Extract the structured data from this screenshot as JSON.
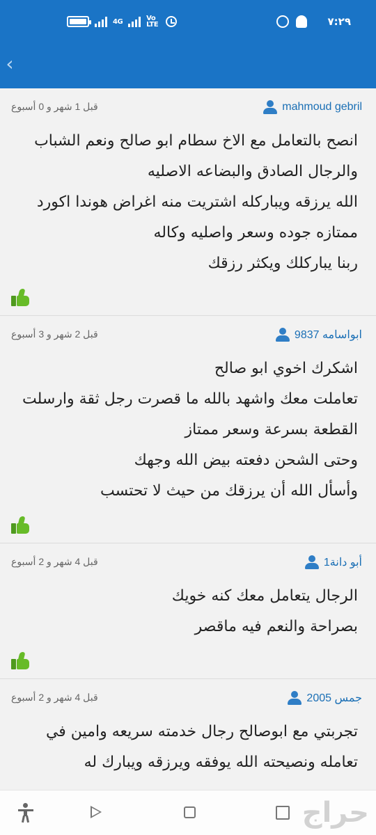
{
  "status_bar": {
    "time": "٧:٢٩",
    "network_label": "4G",
    "volte_label": "Vo LTE",
    "icons": [
      "battery-icon",
      "signal-icon",
      "alarm-icon",
      "whatsapp-icon",
      "snapchat-icon"
    ]
  },
  "app_bar": {
    "back_label": "‹",
    "color": "#1a74c6"
  },
  "reviews": [
    {
      "user": "mahmoud gebril",
      "time": "قبل 1 شهر و 0 أسبوع",
      "lines": [
        "انصح بالتعامل مع الاخ سطام ابو صالح ونعم الشباب",
        "والرجال الصادق والبضاعه الاصليه",
        "الله يرزقه ويباركله اشتريت منه اغراض هوندا اكورد",
        "ممتازه جوده وسعر واصليه وكاله",
        "ربنا يباركلك ويكثر رزقك"
      ]
    },
    {
      "user": "ابواسامه 9837",
      "time": "قبل 2 شهر و 3 أسبوع",
      "lines": [
        "اشكرك اخوي ابو صالح",
        "تعاملت معك  واشهد بالله ما قصرت رجل ثقة وارسلت",
        "القطعة بسرعة وسعر ممتاز",
        "وحتى الشحن دفعته بيض الله وجهك",
        "وأسأل الله أن يرزقك من حيث لا تحتسب"
      ]
    },
    {
      "user": "أبو دانة1",
      "time": "قبل 4 شهر و 2 أسبوع",
      "lines": [
        "الرجال يتعامل معك كنه خويك",
        "بصراحة والنعم فيه ماقصر"
      ]
    },
    {
      "user": "جمس 2005",
      "time": "قبل 4 شهر و 2 أسبوع",
      "lines": [
        "تجربتي مع ابوصالح رجال خدمته سريعه وامين في",
        "تعامله ونصيحته الله يوفقه ويرزقه ويبارك له"
      ]
    }
  ],
  "nav_bar": {
    "watermark": "حراج"
  },
  "colors": {
    "accent": "#1a74c6",
    "username": "#1a6fb5",
    "like": "#67bb28"
  }
}
